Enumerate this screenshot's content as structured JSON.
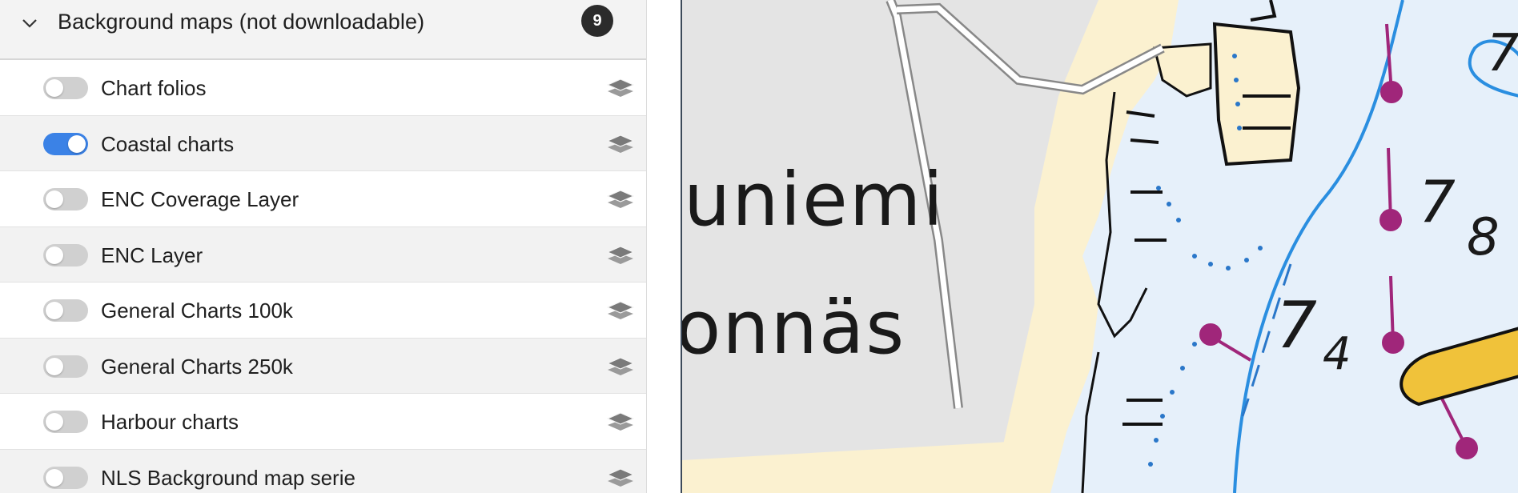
{
  "group": {
    "title": "Background maps (not downloadable)",
    "count": "9",
    "expanded": true
  },
  "layers": [
    {
      "label": "Chart folios",
      "enabled": false
    },
    {
      "label": "Coastal charts",
      "enabled": true
    },
    {
      "label": "ENC Coverage Layer",
      "enabled": false
    },
    {
      "label": "ENC Layer",
      "enabled": false
    },
    {
      "label": "General Charts 100k",
      "enabled": false
    },
    {
      "label": "General Charts 250k",
      "enabled": false
    },
    {
      "label": "Harbour charts",
      "enabled": false
    },
    {
      "label": "NLS Background map serie",
      "enabled": false
    }
  ],
  "map": {
    "place_labels": [
      "uniemi",
      "onnäs"
    ],
    "depth_labels": [
      "7",
      "7",
      "8",
      "7",
      "4"
    ]
  },
  "colors": {
    "toggle_on": "#3b82e6",
    "toggle_off": "#d0d0d0",
    "badge": "#2b2b2b",
    "water": "#e6f0fa",
    "land": "#fbf1d0",
    "built_area": "#e4e4e4"
  },
  "icons": {
    "group_toggle": "chevron-down-icon",
    "layer_options": "layers-icon"
  }
}
